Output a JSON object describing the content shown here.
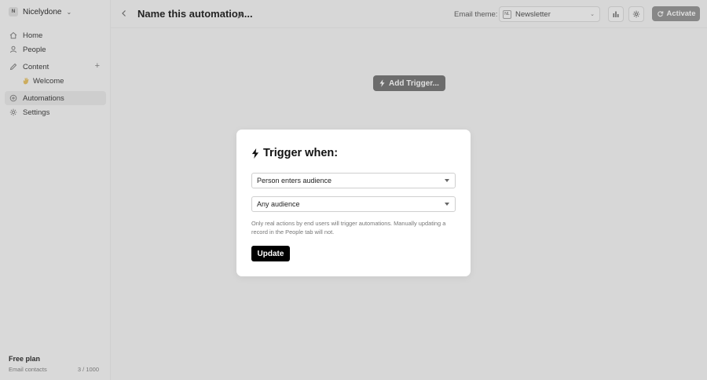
{
  "sidebar": {
    "workspace_badge": "N",
    "workspace_name": "Nicelydone",
    "items": [
      {
        "label": "Home",
        "icon": "home-icon"
      },
      {
        "label": "People",
        "icon": "person-icon"
      },
      {
        "label": "Content",
        "icon": "pen-icon"
      },
      {
        "label": "Welcome",
        "icon": "hand-wave-icon"
      },
      {
        "label": "Automations",
        "icon": "automation-icon"
      },
      {
        "label": "Settings",
        "icon": "gear-icon"
      }
    ],
    "plan": "Free plan",
    "contacts_label": "Email contacts",
    "contacts_value": "3 / 1000"
  },
  "header": {
    "title": "Name this automation...",
    "email_theme_label": "Email theme:",
    "theme_badge": "NL",
    "theme_value": "Newsletter",
    "activate_label": "Activate"
  },
  "canvas": {
    "add_trigger_label": "Add Trigger..."
  },
  "modal": {
    "title": "Trigger when:",
    "event_select": "Person enters audience",
    "audience_select": "Any audience",
    "note": "Only real actions by end users will trigger automations. Manually updating a record in the People tab will not.",
    "update_label": "Update"
  },
  "colors": {
    "activate_bg": "#9a9a9a",
    "update_bg": "#000000",
    "add_trigger_bg": "#7b7b7b"
  }
}
